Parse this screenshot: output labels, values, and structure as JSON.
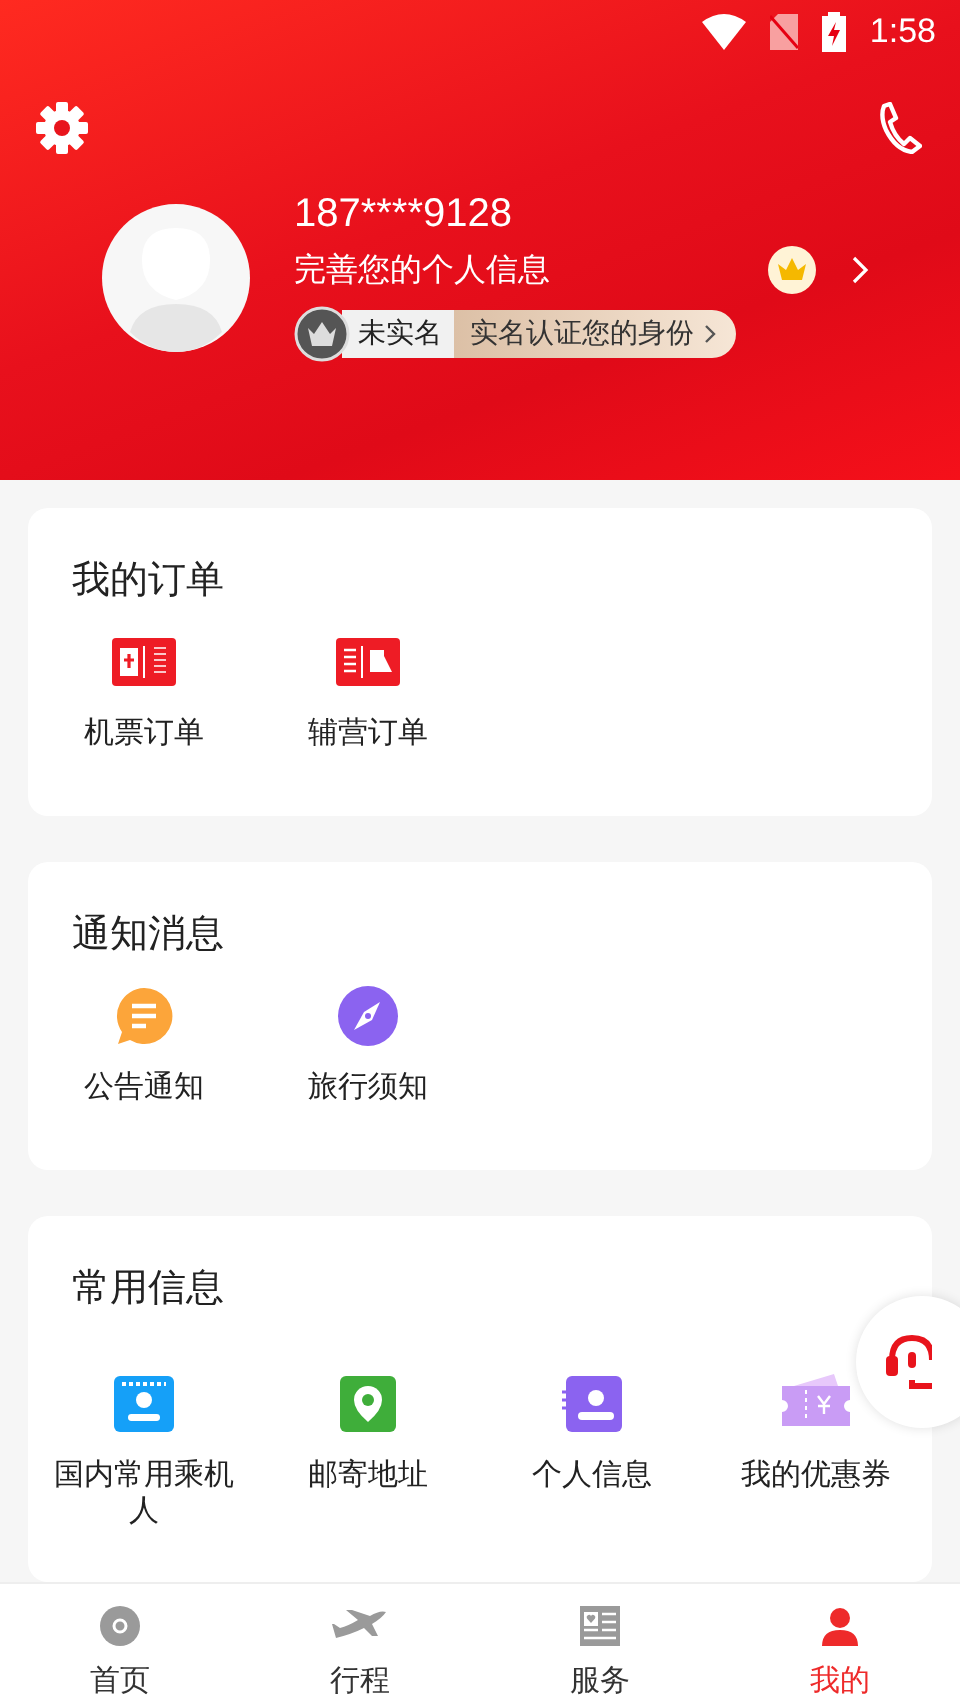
{
  "status_bar": {
    "time": "1:58"
  },
  "profile": {
    "phone": "187****9128",
    "prompt": "完善您的个人信息",
    "verify_status": "未实名",
    "verify_action": "实名认证您的身份"
  },
  "sections": [
    {
      "title": "我的订单",
      "items": [
        {
          "label": "机票订单",
          "kind": "ticket"
        },
        {
          "label": "辅营订单",
          "kind": "extra"
        }
      ]
    },
    {
      "title": "通知消息",
      "items": [
        {
          "label": "公告通知",
          "kind": "notice"
        },
        {
          "label": "旅行须知",
          "kind": "compass"
        }
      ]
    },
    {
      "title": "常用信息",
      "items": [
        {
          "label": "国内常用乘机人",
          "kind": "passenger"
        },
        {
          "label": "邮寄地址",
          "kind": "address"
        },
        {
          "label": "个人信息",
          "kind": "contact"
        },
        {
          "label": "我的优惠券",
          "kind": "coupon"
        }
      ]
    }
  ],
  "tabs": [
    {
      "label": "首页",
      "kind": "home",
      "selected": false
    },
    {
      "label": "行程",
      "kind": "trip",
      "selected": false
    },
    {
      "label": "服务",
      "kind": "service",
      "selected": false
    },
    {
      "label": "我的",
      "kind": "me",
      "selected": true
    }
  ]
}
